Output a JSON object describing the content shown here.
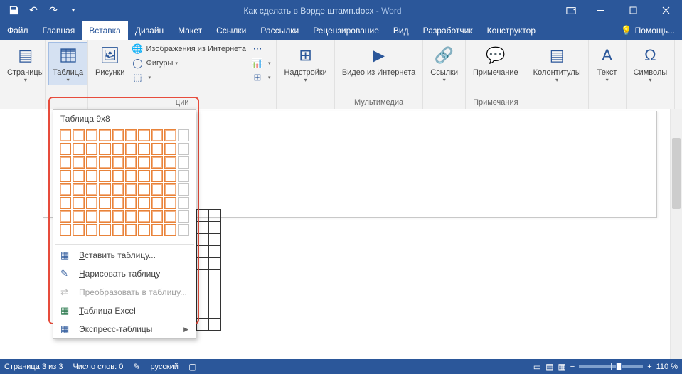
{
  "title": {
    "filename": "Как сделать в Ворде штамп.docx",
    "app": "Word"
  },
  "tabs": {
    "file": "Файл",
    "items": [
      "Главная",
      "Вставка",
      "Дизайн",
      "Макет",
      "Ссылки",
      "Рассылки",
      "Рецензирование",
      "Вид",
      "Разработчик",
      "Конструктор"
    ],
    "active_index": 1,
    "tellme": "Помощь..."
  },
  "ribbon": {
    "pages": "Страницы",
    "table": "Таблица",
    "pictures": "Рисунки",
    "online_pics": "Изображения из Интернета",
    "shapes": "Фигуры",
    "illustrations_group": "ции",
    "addins": "Надстройки",
    "video": "Видео из Интернета",
    "media_group": "Мультимедиа",
    "links": "Ссылки",
    "comment": "Примечание",
    "comments_group": "Примечания",
    "header_footer": "Колонтитулы",
    "text": "Текст",
    "symbols": "Символы"
  },
  "table_dropdown": {
    "header": "Таблица 9x8",
    "grid": {
      "cols": 10,
      "rows": 8,
      "sel_cols": 9,
      "sel_rows": 8
    },
    "insert": "Вставить таблицу...",
    "draw": "Нарисовать таблицу",
    "convert": "Преобразовать в таблицу...",
    "excel": "Таблица Excel",
    "quick": "Экспресс-таблицы"
  },
  "status": {
    "page": "Страница 3 из 3",
    "words": "Число слов: 0",
    "language": "русский",
    "zoom": "110 %"
  }
}
